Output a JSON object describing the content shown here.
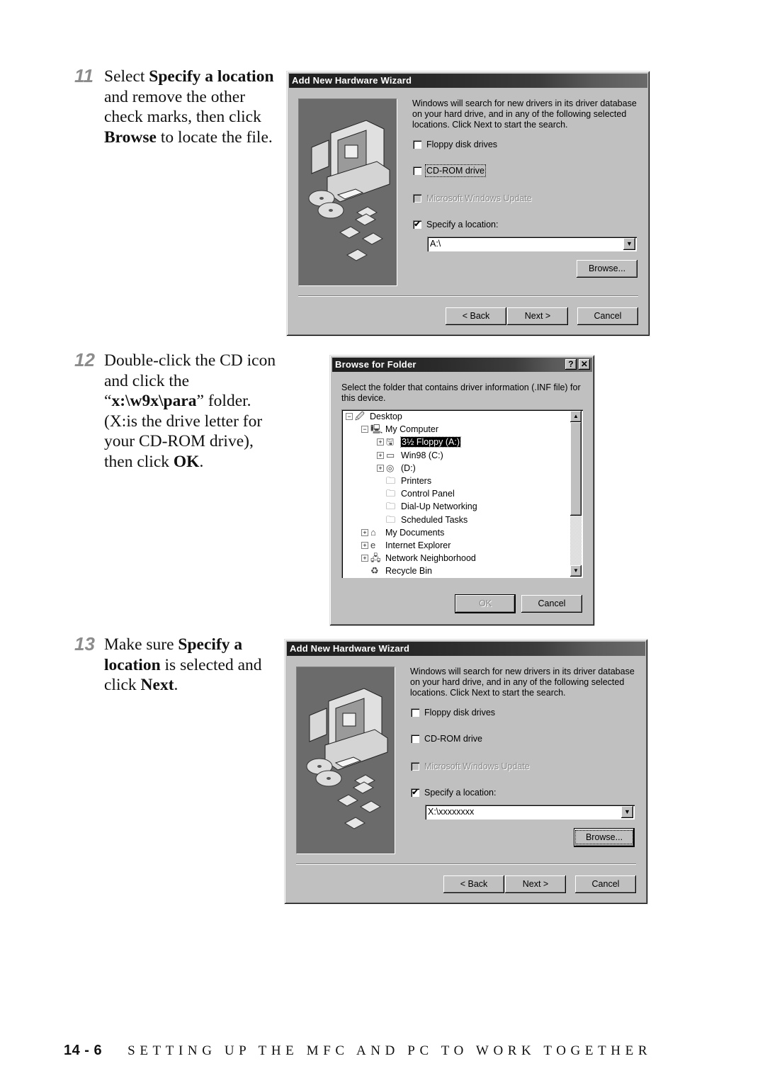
{
  "steps": [
    {
      "number": "11",
      "text_parts": [
        {
          "t": "Select ",
          "b": false
        },
        {
          "t": "Specify a location",
          "b": true
        },
        {
          "t": " and remove the other check marks, then click ",
          "b": false
        },
        {
          "t": "Browse",
          "b": true
        },
        {
          "t": " to locate the file.",
          "b": false
        }
      ]
    },
    {
      "number": "12",
      "text_parts": [
        {
          "t": "Double-click the CD icon and click the “",
          "b": false
        },
        {
          "t": "x:\\w9x\\para",
          "b": true
        },
        {
          "t": "” folder. (X:is the drive letter for your CD-ROM drive), then click ",
          "b": false
        },
        {
          "t": "OK",
          "b": true
        },
        {
          "t": ".",
          "b": false
        }
      ]
    },
    {
      "number": "13",
      "text_parts": [
        {
          "t": "Make sure ",
          "b": false
        },
        {
          "t": "Specify a location",
          "b": true
        },
        {
          "t": " is selected and click ",
          "b": false
        },
        {
          "t": "Next",
          "b": true
        },
        {
          "t": ".",
          "b": false
        }
      ]
    }
  ],
  "wizard1": {
    "title": "Add New Hardware Wizard",
    "intro": "Windows will search for new drivers in its driver database on your hard drive, and in any of the following selected locations. Click Next to start the search.",
    "options": [
      {
        "label": "Floppy disk drives",
        "checked": false,
        "enabled": true
      },
      {
        "label": "CD-ROM drive",
        "checked": false,
        "enabled": true,
        "focused": true
      },
      {
        "label": "Microsoft Windows Update",
        "checked": false,
        "enabled": false
      },
      {
        "label": "Specify a location:",
        "checked": true,
        "enabled": true
      }
    ],
    "location_value": "A:\\",
    "browse_label": "Browse...",
    "back_label": "< Back",
    "next_label": "Next >",
    "cancel_label": "Cancel"
  },
  "browse_dialog": {
    "title": "Browse for Folder",
    "help_label": "?",
    "close_label": "✕",
    "prompt": "Select the folder that contains driver information (.INF file) for this device.",
    "tree": [
      {
        "label": "Desktop",
        "level": 0,
        "expander": "minus",
        "icon": "desktop-icon"
      },
      {
        "label": "My Computer",
        "level": 1,
        "expander": "minus",
        "icon": "my-computer-icon"
      },
      {
        "label": "3½ Floppy (A:)",
        "level": 2,
        "expander": "plus",
        "icon": "floppy-drive-icon",
        "selected": true
      },
      {
        "label": "Win98 (C:)",
        "level": 2,
        "expander": "plus",
        "icon": "hard-drive-icon"
      },
      {
        "label": "(D:)",
        "level": 2,
        "expander": "plus",
        "icon": "cd-drive-icon"
      },
      {
        "label": "Printers",
        "level": 2,
        "expander": "none",
        "icon": "printers-folder-icon"
      },
      {
        "label": "Control Panel",
        "level": 2,
        "expander": "none",
        "icon": "control-panel-icon"
      },
      {
        "label": "Dial-Up Networking",
        "level": 2,
        "expander": "none",
        "icon": "dialup-networking-icon"
      },
      {
        "label": "Scheduled Tasks",
        "level": 2,
        "expander": "none",
        "icon": "scheduled-tasks-icon"
      },
      {
        "label": "My Documents",
        "level": 1,
        "expander": "plus",
        "icon": "my-documents-icon"
      },
      {
        "label": "Internet Explorer",
        "level": 1,
        "expander": "plus",
        "icon": "internet-explorer-icon"
      },
      {
        "label": "Network Neighborhood",
        "level": 1,
        "expander": "plus",
        "icon": "network-neighborhood-icon"
      },
      {
        "label": "Recycle Bin",
        "level": 1,
        "expander": "none",
        "icon": "recycle-bin-icon"
      }
    ],
    "ok_label": "OK",
    "cancel_label": "Cancel"
  },
  "wizard2": {
    "title": "Add New Hardware Wizard",
    "intro": "Windows will search for new drivers in its driver database on your hard drive, and in any of the following selected locations. Click Next to start the search.",
    "options": [
      {
        "label": "Floppy disk drives",
        "checked": false,
        "enabled": true
      },
      {
        "label": "CD-ROM drive",
        "checked": false,
        "enabled": true
      },
      {
        "label": "Microsoft Windows Update",
        "checked": false,
        "enabled": false
      },
      {
        "label": "Specify a location:",
        "checked": true,
        "enabled": true
      }
    ],
    "location_value": "X:\\xxxxxxxx",
    "browse_label": "Browse...",
    "back_label": "< Back",
    "next_label": "Next >",
    "cancel_label": "Cancel"
  },
  "footer": {
    "page": "14 - 6",
    "chapter": "SETTING UP THE MFC AND PC TO WORK TOGETHER"
  }
}
